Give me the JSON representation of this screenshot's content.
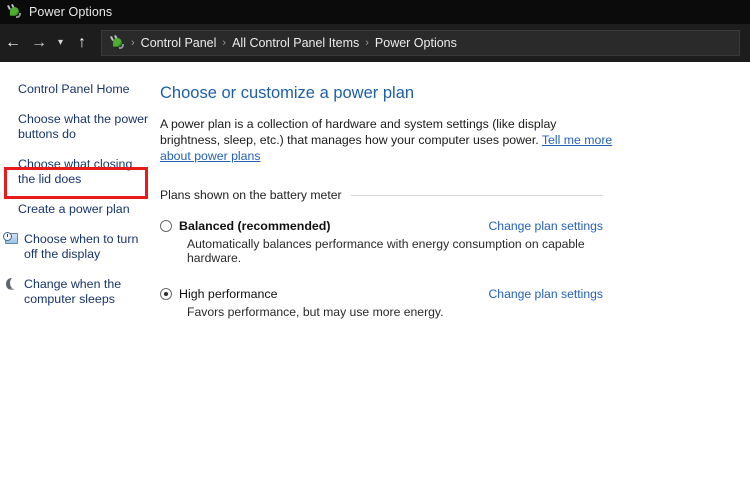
{
  "window": {
    "title": "Power Options",
    "title_icon": "power-plug-icon"
  },
  "toolbar": {
    "back_icon": "back-arrow-icon",
    "forward_icon": "forward-arrow-icon",
    "history_icon": "chevron-down-icon",
    "up_icon": "up-arrow-icon",
    "address_icon": "power-plug-icon",
    "separator": "›",
    "breadcrumbs": [
      {
        "label": "Control Panel"
      },
      {
        "label": "All Control Panel Items"
      },
      {
        "label": "Power Options"
      }
    ]
  },
  "sidebar": {
    "items": [
      {
        "label": "Control Panel Home",
        "icon": null,
        "highlighted": false
      },
      {
        "label": "Choose what the power buttons do",
        "icon": null,
        "highlighted": false
      },
      {
        "label": "Choose what closing the lid does",
        "icon": null,
        "highlighted": true
      },
      {
        "label": "Create a power plan",
        "icon": null,
        "highlighted": false
      },
      {
        "label": "Choose when to turn off the display",
        "icon": "display-clock-icon",
        "highlighted": false
      },
      {
        "label": "Change when the computer sleeps",
        "icon": "sleep-moon-icon",
        "highlighted": false
      }
    ]
  },
  "main": {
    "page_title": "Choose or customize a power plan",
    "intro_text": "A power plan is a collection of hardware and system settings (like display brightness, sleep, etc.) that manages how your computer uses power. ",
    "intro_link": "Tell me more about power plans",
    "section_label": "Plans shown on the battery meter",
    "plans": [
      {
        "name": "Balanced (recommended)",
        "description": "Automatically balances performance with energy consumption on capable hardware.",
        "selected": false,
        "link": "Change plan settings"
      },
      {
        "name": "High performance",
        "description": "Favors performance, but may use more energy.",
        "selected": true,
        "link": "Change plan settings"
      }
    ]
  },
  "colors": {
    "titlebar_bg": "#0b0b0b",
    "toolbar_bg": "#1d1d1d",
    "link_blue": "#2461b5",
    "sidebar_link": "#16356b",
    "heading_blue": "#1c5fa8",
    "highlight_red": "#e81b1b"
  }
}
